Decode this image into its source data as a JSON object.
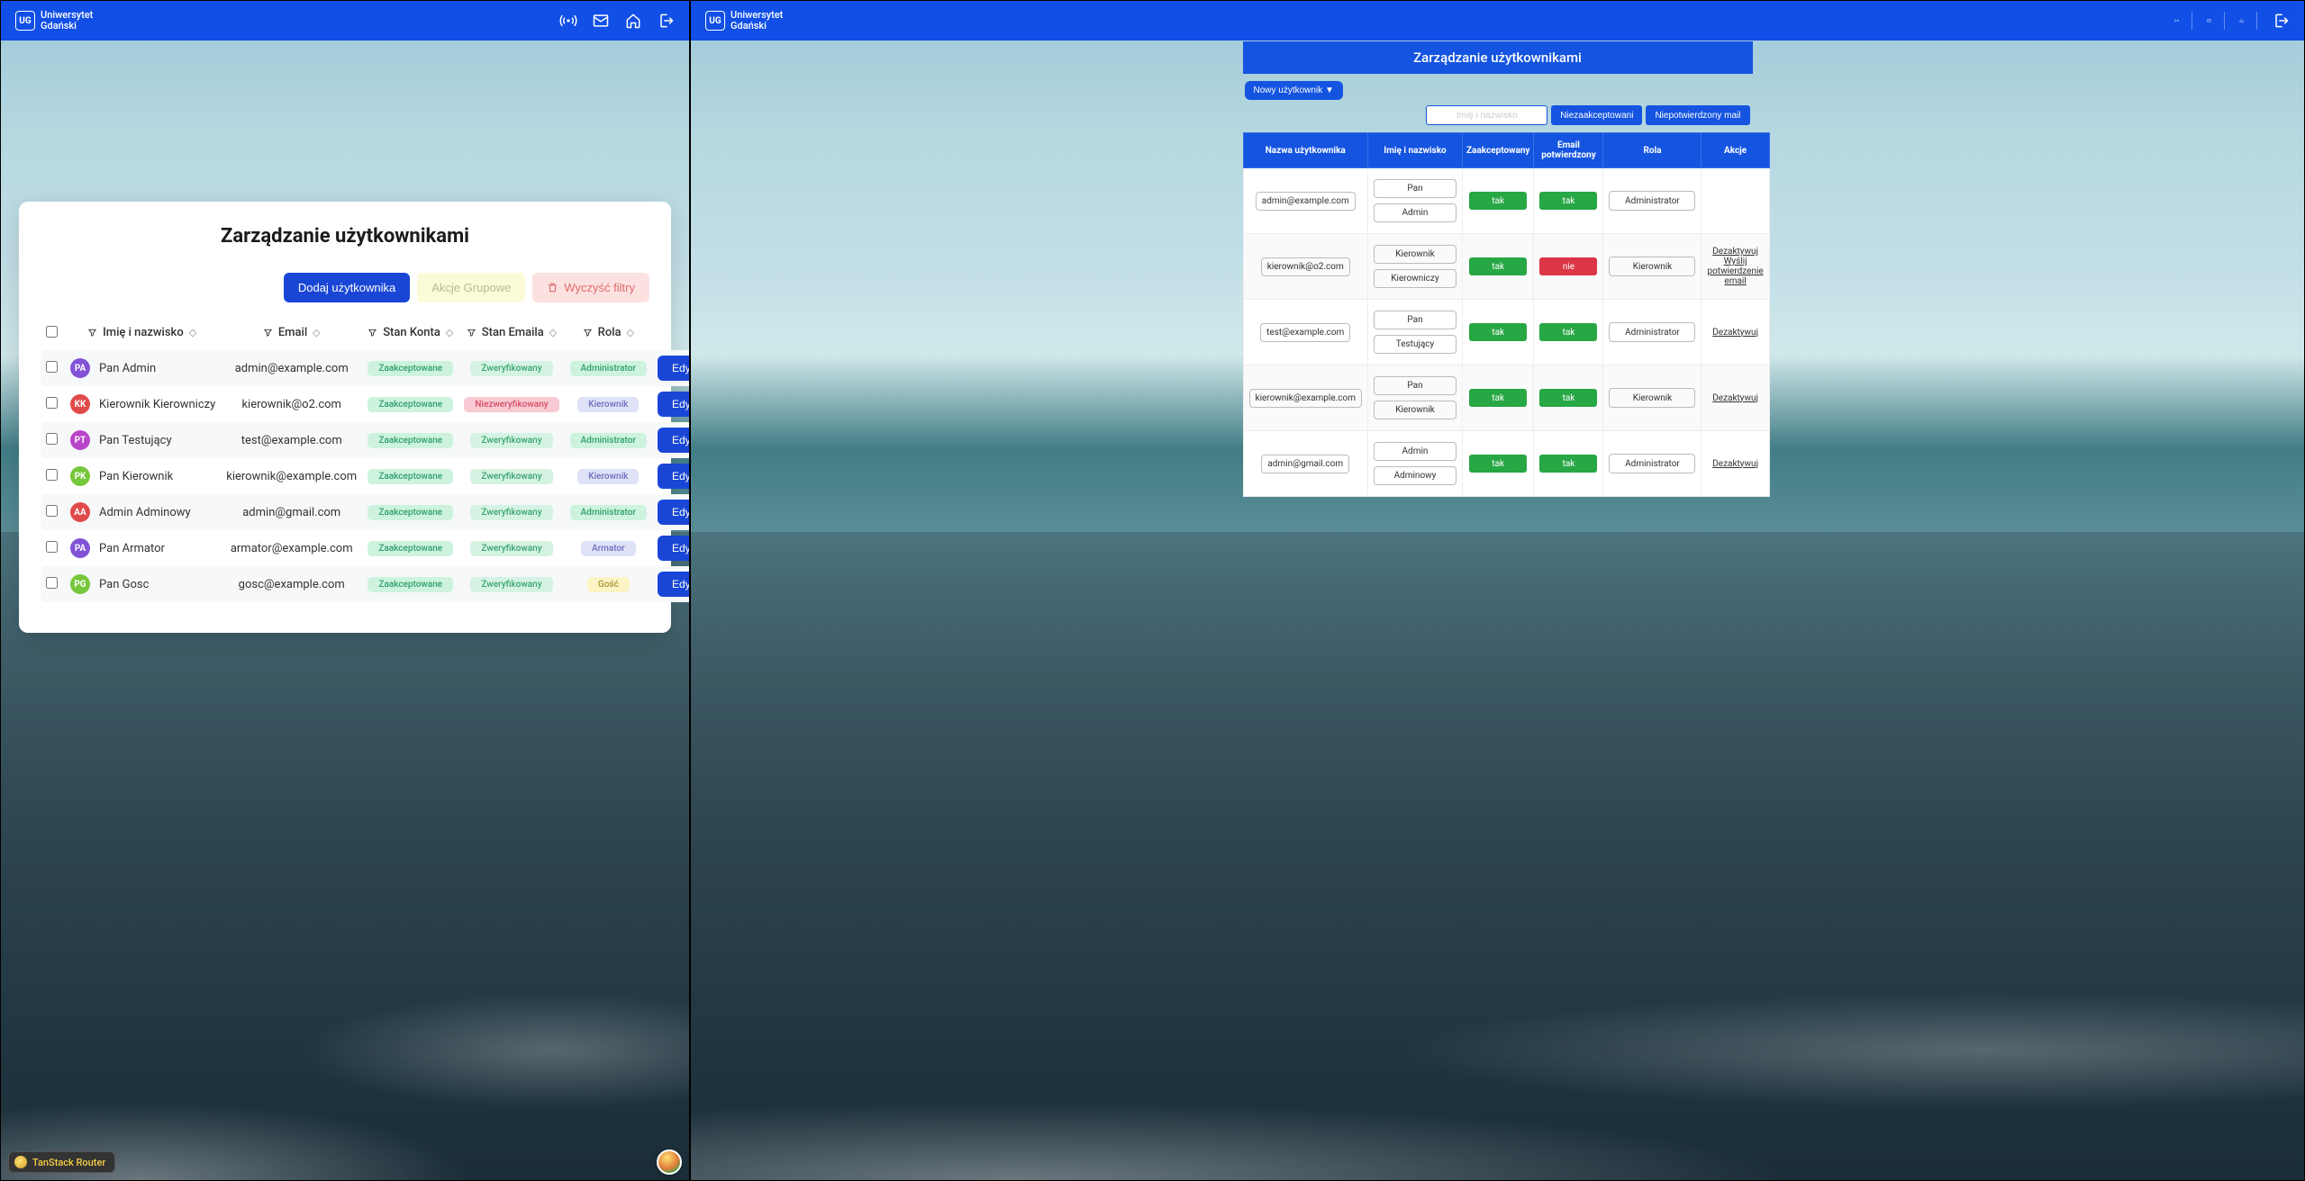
{
  "brand": {
    "mark": "UG",
    "line1": "Uniwersytet",
    "line2": "Gdański"
  },
  "left": {
    "title": "Zarządzanie użytkownikami",
    "buttons": {
      "add": "Dodaj użytkownika",
      "group": "Akcje Grupowe",
      "clear": "Wyczyść filtry"
    },
    "columns": {
      "name": "Imię i nazwisko",
      "email": "Email",
      "acct": "Stan Konta",
      "emailState": "Stan Emaila",
      "role": "Rola"
    },
    "tags": {
      "accepted": "Zaakceptowane",
      "verified": "Zweryfikowany",
      "unverified": "Niezweryfikowany",
      "admin": "Administrator",
      "kier": "Kierownik",
      "armator": "Armator",
      "gosc": "Gość"
    },
    "editLabel": "Edytuj",
    "rows": [
      {
        "initials": "PA",
        "color": "#8252d6",
        "name": "Pan Admin",
        "email": "admin@example.com",
        "emailState": "verified",
        "role": "admin"
      },
      {
        "initials": "KK",
        "color": "#e14a4a",
        "name": "Kierownik Kierowniczy",
        "email": "kierownik@o2.com",
        "emailState": "unverified",
        "role": "kier"
      },
      {
        "initials": "PT",
        "color": "#b845c7",
        "name": "Pan Testujący",
        "email": "test@example.com",
        "emailState": "verified",
        "role": "admin"
      },
      {
        "initials": "PK",
        "color": "#77c73a",
        "name": "Pan Kierownik",
        "email": "kierownik@example.com",
        "emailState": "verified",
        "role": "kier"
      },
      {
        "initials": "AA",
        "color": "#e14a4a",
        "name": "Admin Adminowy",
        "email": "admin@gmail.com",
        "emailState": "verified",
        "role": "admin"
      },
      {
        "initials": "PA",
        "color": "#8252d6",
        "name": "Pan Armator",
        "email": "armator@example.com",
        "emailState": "verified",
        "role": "armator"
      },
      {
        "initials": "PG",
        "color": "#77c73a",
        "name": "Pan Gosc",
        "email": "gosc@example.com",
        "emailState": "verified",
        "role": "gosc"
      }
    ],
    "tanstack": "TanStack Router"
  },
  "right": {
    "title": "Zarządzanie użytkownikami",
    "newUser": "Nowy użytkownik ▼",
    "searchPlaceholder": "Imię i nazwisko",
    "filters": {
      "notAccepted": "Niezaakceptowani",
      "notConfirmed": "Niepotwierdzony mail"
    },
    "columns": {
      "user": "Nazwa użytkownika",
      "name": "Imię i nazwisko",
      "accepted": "Zaakceptowany",
      "emailConfirmed": "Email potwierdzony",
      "role": "Rola",
      "actions": "Akcje"
    },
    "yes": "tak",
    "no": "nie",
    "actionLabels": {
      "deactivate": "Dezaktywuj",
      "resend": "Wyślij potwierdzenie email"
    },
    "rows": [
      {
        "user": "admin@example.com",
        "name1": "Pan",
        "name2": "Admin",
        "accepted": true,
        "emailConfirmed": true,
        "role": "Administrator",
        "actions": []
      },
      {
        "user": "kierownik@o2.com",
        "name1": "Kierownik",
        "name2": "Kierowniczy",
        "accepted": true,
        "emailConfirmed": false,
        "role": "Kierownik",
        "actions": [
          "deactivate",
          "resend"
        ]
      },
      {
        "user": "test@example.com",
        "name1": "Pan",
        "name2": "Testujący",
        "accepted": true,
        "emailConfirmed": true,
        "role": "Administrator",
        "actions": [
          "deactivate"
        ]
      },
      {
        "user": "kierownik@example.com",
        "name1": "Pan",
        "name2": "Kierownik",
        "accepted": true,
        "emailConfirmed": true,
        "role": "Kierownik",
        "actions": [
          "deactivate"
        ]
      },
      {
        "user": "admin@gmail.com",
        "name1": "Admin",
        "name2": "Adminowy",
        "accepted": true,
        "emailConfirmed": true,
        "role": "Administrator",
        "actions": [
          "deactivate"
        ]
      }
    ]
  }
}
